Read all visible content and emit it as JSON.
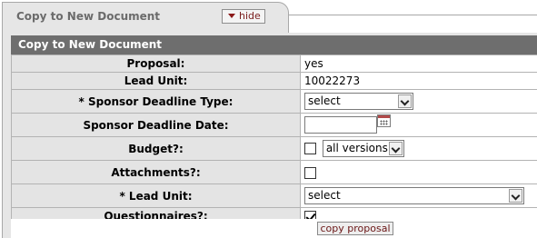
{
  "tab": {
    "title": "Copy to New Document",
    "hide_label": "hide"
  },
  "section": {
    "header": "Copy to New Document"
  },
  "form": {
    "proposal_label": "Proposal:",
    "proposal_value": "yes",
    "lead_unit_label": "Lead Unit:",
    "lead_unit_value": "10022273",
    "sponsor_deadline_type_label": "* Sponsor Deadline Type:",
    "sponsor_deadline_type_value": "select",
    "sponsor_deadline_date_label": "Sponsor Deadline Date:",
    "sponsor_deadline_date_value": "",
    "budget_label": "Budget?:",
    "budget_checked": false,
    "budget_versions_value": "all versions",
    "attachments_label": "Attachments?:",
    "attachments_checked": false,
    "lead_unit_select_label": "* Lead Unit:",
    "lead_unit_select_value": "select",
    "questionnaires_label": "Questionnaires?:",
    "questionnaires_checked": true
  },
  "actions": {
    "copy_proposal_label": "copy proposal"
  },
  "icons": {
    "hide": "triangle-down-icon",
    "calendar": "calendar-icon",
    "dropdown": "chevron-down-icon"
  }
}
